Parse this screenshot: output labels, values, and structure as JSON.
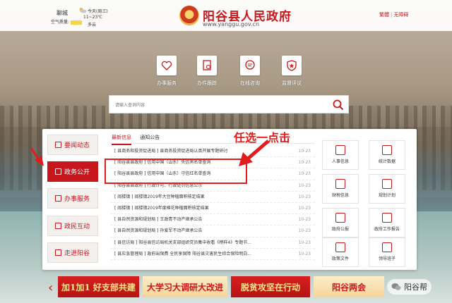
{
  "header": {
    "weather": {
      "city": "聊城",
      "aq_label": "空气质量:",
      "day": "今天(周三)",
      "temp": "11~23℃",
      "cond": "多云"
    },
    "title": "阳谷县人民政府",
    "url": "www.yanggu.gov.cn",
    "links": [
      "繁體",
      "无障碍"
    ]
  },
  "services": [
    {
      "label": "办事服务",
      "icon": "heart-icon"
    },
    {
      "label": "办件跟踪",
      "icon": "document-search-icon"
    },
    {
      "label": "在线咨询",
      "icon": "chat-icon"
    },
    {
      "label": "监督评议",
      "icon": "shield-star-icon"
    }
  ],
  "search": {
    "placeholder": "请输入查询内容"
  },
  "sidenav": [
    {
      "label": "要闻动态",
      "active": false
    },
    {
      "label": "政务公开",
      "active": true
    },
    {
      "label": "办事服务",
      "active": false
    },
    {
      "label": "政民互动",
      "active": false
    },
    {
      "label": "走进阳谷",
      "active": false
    }
  ],
  "tabs": [
    "最新信息",
    "通知公告"
  ],
  "news": [
    {
      "title": "[ 县商务和投资促进局 ] 县商务投资促进局认真开展专题研讨",
      "date": "10-23"
    },
    {
      "title": "[ 阳谷县县政府 ] 信用中国（山东）失信黑名单查询",
      "date": "10-23"
    },
    {
      "title": "[ 阳谷县县政府 ] 信用中国（山东）守信红名单查询",
      "date": "10-23"
    },
    {
      "title": "[ 阳谷县县政府 ] 行政许可、行政处罚信息公示",
      "date": "10-23"
    },
    {
      "title": "[ 阎楼镇 ] 阎楼镇2019年大豆种植面积核定结果",
      "date": "10-23"
    },
    {
      "title": "[ 阎楼镇 ] 阎楼镇2019年度棉花种植面积核定结果",
      "date": "10-23"
    },
    {
      "title": "[ 县自然资源和规划局 ] 王政青不动产继承公告",
      "date": "10-23"
    },
    {
      "title": "[ 县自然资源和规划局 ] 孙爱军不动产继承公告",
      "date": "10-23"
    },
    {
      "title": "[ 县信访局 ] 阳谷县信访局机关支部组织党员集中收看《榜样4》专题节...",
      "date": "10-23"
    },
    {
      "title": "[ 县应急管理局 ] 政府出保费 全民享保障 阳谷县灾害民生综合保险明白...",
      "date": "10-23"
    }
  ],
  "grid": [
    "人事信息",
    "统计数据",
    "财税信息",
    "规划计划",
    "政府公报",
    "政府工作报告",
    "政策文件",
    "领导班子"
  ],
  "annotation": "任选一点击",
  "banners": [
    "加1加1 好支部共建",
    "大学习大调研大改进",
    "脱贫攻坚在行动",
    "阳谷两会"
  ],
  "watermark": "阳谷帮"
}
